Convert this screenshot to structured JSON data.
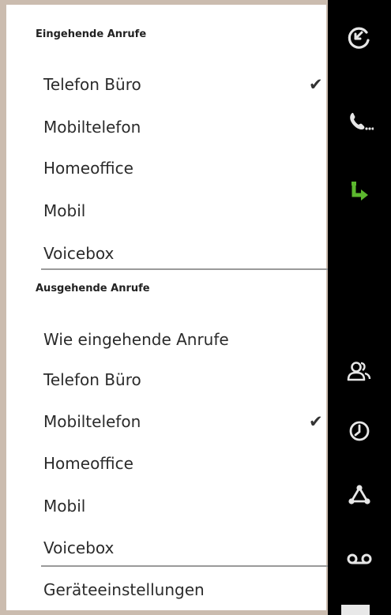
{
  "incoming": {
    "title": "Eingehende Anrufe",
    "items": [
      {
        "label": "Telefon Büro",
        "checked": true
      },
      {
        "label": "Mobiltelefon",
        "checked": false
      },
      {
        "label": "Homeoffice",
        "checked": false
      },
      {
        "label": "Mobil",
        "checked": false
      },
      {
        "label": "Voicebox",
        "checked": false
      }
    ]
  },
  "outgoing": {
    "title": "Ausgehende Anrufe",
    "items": [
      {
        "label": "Wie eingehende Anrufe",
        "checked": false
      },
      {
        "label": "Telefon Büro",
        "checked": false
      },
      {
        "label": "Mobiltelefon",
        "checked": true
      },
      {
        "label": "Homeoffice",
        "checked": false
      },
      {
        "label": "Mobil",
        "checked": false
      },
      {
        "label": "Voicebox",
        "checked": false
      }
    ]
  },
  "footer": {
    "device_settings_label": "Geräteeinstellungen"
  },
  "check_glyph": "✔",
  "rail": {
    "icons": [
      {
        "name": "callback-icon"
      },
      {
        "name": "phone-more-icon"
      },
      {
        "name": "call-forward-icon",
        "active": true,
        "color": "#5cb82e"
      },
      {
        "name": "contacts-icon"
      },
      {
        "name": "history-icon"
      },
      {
        "name": "network-icon"
      },
      {
        "name": "voicemail-icon"
      }
    ]
  },
  "colors": {
    "accent_green": "#5cb82e",
    "rail_bg": "#000000",
    "menu_bg": "#ffffff",
    "menu_frame": "#cbbcaf"
  }
}
